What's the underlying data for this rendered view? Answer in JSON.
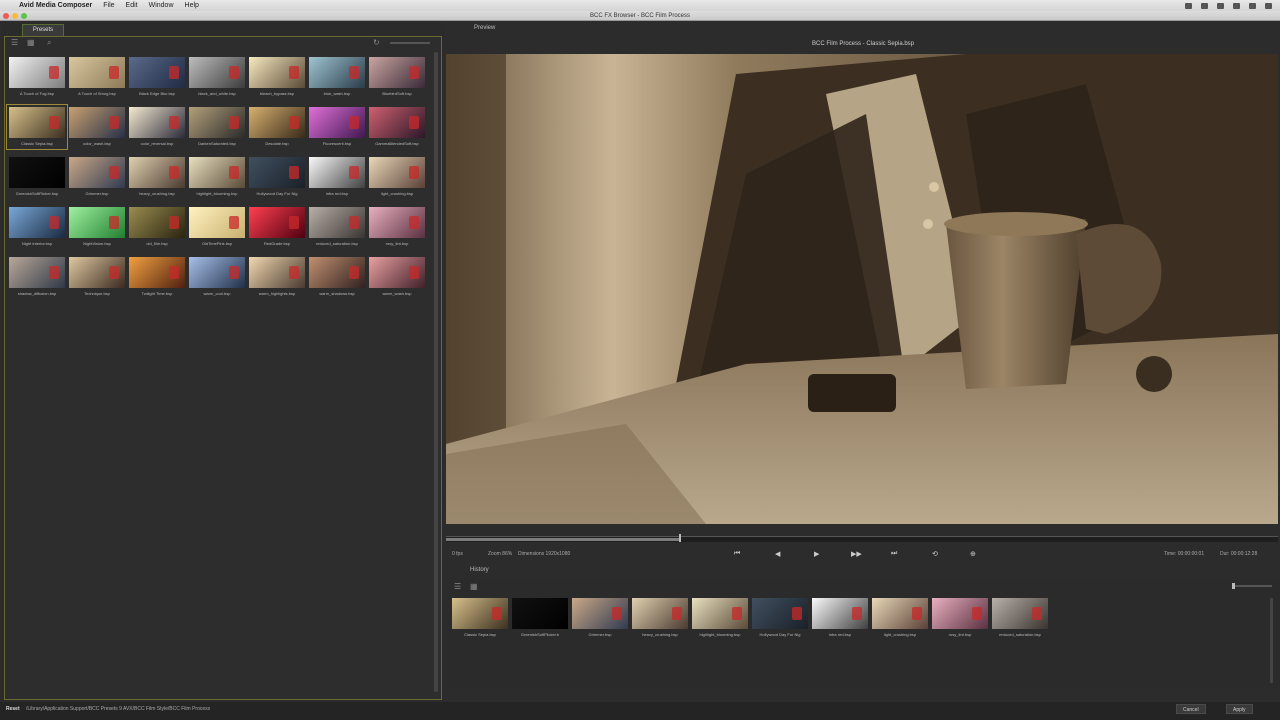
{
  "menubar": {
    "app": "Avid Media Composer",
    "items": [
      "File",
      "Edit",
      "Window",
      "Help"
    ]
  },
  "window_title": "BCC FX Browser - BCC Film Process",
  "left": {
    "tab": "Presets",
    "presets": [
      "A Touch of Fog.bsp",
      "A Touch of Smog.bsp",
      "Black Edge Blur.bsp",
      "black_and_white.bsp",
      "bleach_bypass.bsp",
      "blue_wash.bsp",
      "BluebirdSoft.bsp",
      "Classic Sepia.bsp",
      "color_wash.bsp",
      "color_reversal.bsp",
      "DarkenSaturated.bsp",
      "Desolate.bsp",
      "Fluorescent.bsp",
      "GammaBlendedSoft.bsp",
      "GreenishSoftFlicker.bsp",
      "Grimmer.bsp",
      "heavy_crushing.bsp",
      "highlight_blooming.bsp",
      "Hollywood Day For Nig",
      "infra red.bsp",
      "light_crushing.bsp",
      "Night Interior.bsp",
      "NightVision.bsp",
      "old_film.bsp",
      "OldTimePink.bsp",
      "RedGrade.bsp",
      "reduced_saturation.bsp",
      "rosy_tint.bsp",
      "shadow_diffusion.bsp",
      "Technique.bsp",
      "Twilight Time.bsp",
      "warm_cool.bsp",
      "warm_highlights.bsp",
      "warm_shadows.bsp",
      "warm_wash.bsp"
    ],
    "selected_index": 7
  },
  "preview": {
    "tab": "Preview",
    "title": "BCC Film Process - Classic Sepia.bsp",
    "fps": "0 fps",
    "zoom": "Zoom 86%",
    "dimensions": "Dimensions 1920x1080",
    "time": "Time: 00:00:00:01",
    "dur": "Dur: 00:00:12:28",
    "transport": [
      "⏮",
      "◀",
      "▶",
      "▶▶",
      "⏭",
      "⟲",
      "⊕"
    ],
    "progress": 0.28
  },
  "history": {
    "label": "History",
    "items": [
      "Classic Sepia.bsp",
      "GreenishSoftFlicker.b",
      "Grimmer.bsp",
      "heavy_crushing.bsp",
      "highlight_blooming.bsp",
      "Hollywood Day For Nig",
      "infra red.bsp",
      "light_crushing.bsp",
      "rosy_tint.bsp",
      "reduced_saturation.bsp"
    ]
  },
  "status": {
    "label": "Reset",
    "path": "/Library/Application Support/BCC Presets 9 AVX/BCC Film Style/BCC Film Process"
  },
  "buttons": {
    "cancel": "Cancel",
    "apply": "Apply"
  },
  "colors": {
    "accent": "#6b6b2f",
    "sepia": "#8a7252"
  }
}
